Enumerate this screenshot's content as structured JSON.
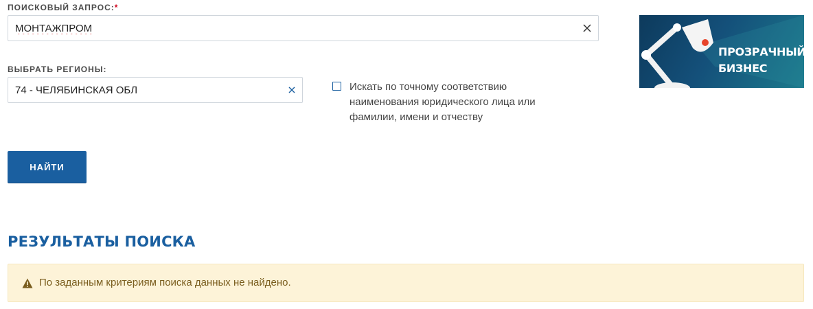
{
  "search_query": {
    "label": "ПОИСКОВЫЙ ЗАПРОС:",
    "required_marker": "*",
    "value": "МОНТАЖПРОМ",
    "clear_icon": "close-icon"
  },
  "regions": {
    "label": "ВЫБРАТЬ РЕГИОНЫ:",
    "selected": "74 - ЧЕЛЯБИНСКАЯ ОБЛ",
    "clear_icon": "close-icon"
  },
  "exact_match": {
    "label": "Искать по точному соответствию наименования юридического лица или фамилии, имени и отчеству",
    "checked": false
  },
  "banner": {
    "line1": "ПРОЗРАЧНЫЙ",
    "line2": "БИЗНЕС",
    "icon": "desk-lamp-icon"
  },
  "search_button": {
    "label": "НАЙТИ"
  },
  "results": {
    "title": "РЕЗУЛЬТАТЫ ПОИСКА",
    "alert_icon": "warning-icon",
    "message": "По заданным критериям поиска данных не найдено."
  },
  "colors": {
    "accent": "#1a5fa0",
    "required": "#d0021b",
    "alert_bg": "#fdf3d8",
    "alert_text": "#7a5d1e"
  }
}
